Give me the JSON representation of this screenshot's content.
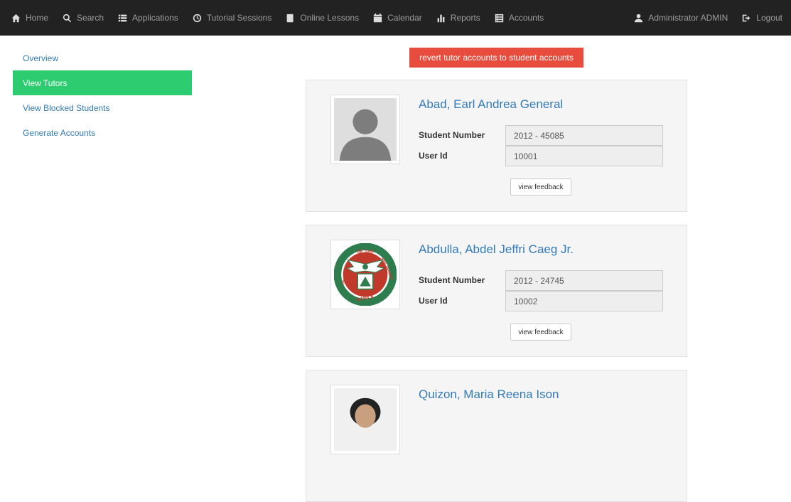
{
  "navbar": {
    "left_items": [
      {
        "label": "Home",
        "icon": "home-icon"
      },
      {
        "label": "Search",
        "icon": "search-icon"
      },
      {
        "label": "Applications",
        "icon": "list-icon"
      },
      {
        "label": "Tutorial Sessions",
        "icon": "clock-icon"
      },
      {
        "label": "Online Lessons",
        "icon": "book-icon"
      },
      {
        "label": "Calendar",
        "icon": "calendar-icon"
      },
      {
        "label": "Reports",
        "icon": "bar-chart-icon"
      },
      {
        "label": "Accounts",
        "icon": "list-alt-icon"
      }
    ],
    "right_items": [
      {
        "label": "Administrator ADMIN",
        "icon": "user-icon"
      },
      {
        "label": "Logout",
        "icon": "logout-icon"
      }
    ]
  },
  "sidebar": {
    "items": [
      {
        "label": "Overview",
        "active": false
      },
      {
        "label": "View Tutors",
        "active": true
      },
      {
        "label": "View Blocked Students",
        "active": false
      },
      {
        "label": "Generate Accounts",
        "active": false
      }
    ]
  },
  "revert_button": {
    "label": "revert tutor accounts to student accounts"
  },
  "fields": {
    "student_number_label": "Student Number",
    "user_id_label": "User Id"
  },
  "feedback_label": "view feedback",
  "tutors": [
    {
      "name": "Abad, Earl Andrea General",
      "student_number": "2012 - 45085",
      "user_id": "10001",
      "avatar": "default-avatar"
    },
    {
      "name": "Abdulla, Abdel Jeffri Caeg Jr.",
      "student_number": "2012 - 24745",
      "user_id": "10002",
      "avatar": "university-seal"
    },
    {
      "name": "Quizon, Maria Reena Ison",
      "avatar": "photo"
    }
  ],
  "seal": {
    "top_text": "OF THE",
    "left_text": "UNIVERSITY",
    "right_text": "PHILIPPINES",
    "bottom_text": "MANILA",
    "year": "1908"
  },
  "colors": {
    "navbar_bg": "#222222",
    "active_sidebar": "#2ecc71",
    "revert_button": "#e74c3c",
    "link": "#337ab7"
  }
}
